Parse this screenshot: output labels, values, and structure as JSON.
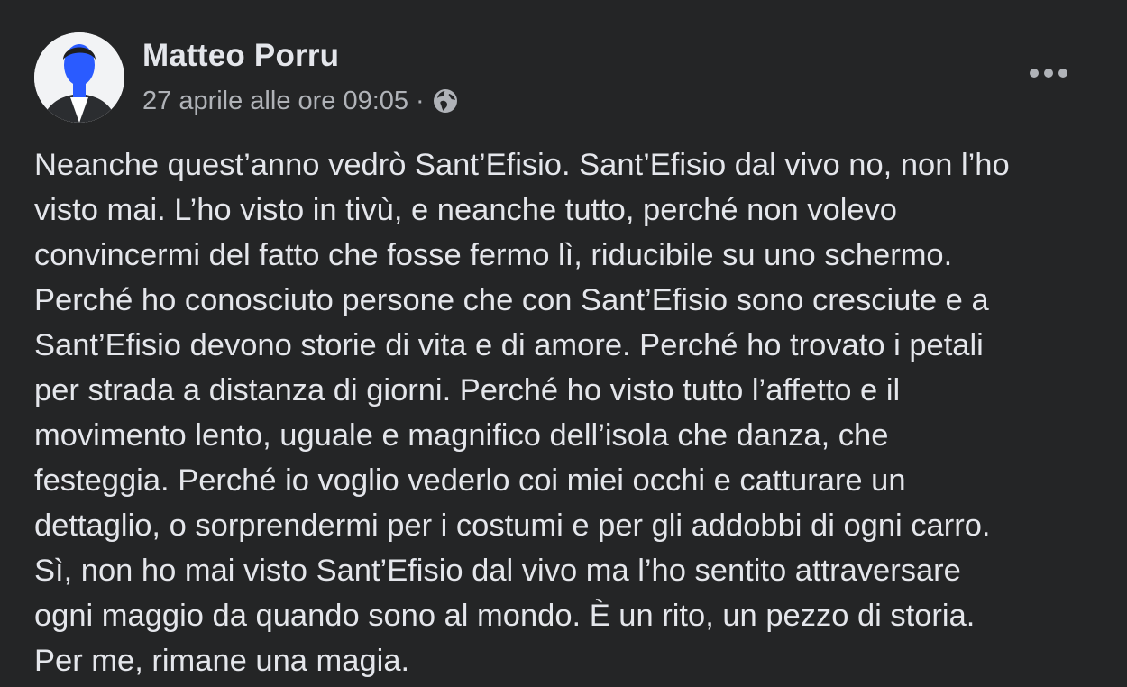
{
  "post": {
    "author": "Matteo Porru",
    "timestamp": "27 aprile alle ore 09:05",
    "separator": "·",
    "privacy_icon": "globe-icon",
    "more_icon": "more-horizontal-icon",
    "avatar_icon": "profile-avatar",
    "text": "Neanche quest’anno vedrò Sant’Efisio. Sant’Efisio dal vivo no, non l’ho\nvisto mai. L’ho visto in tivù, e neanche tutto, perché non volevo\nconvincermi del fatto che fosse fermo lì, riducibile su uno schermo.\nPerché ho conosciuto persone che con Sant’Efisio sono cresciute e a\nSant’Efisio devono storie di vita e di amore. Perché ho trovato i petali\nper strada a distanza di giorni. Perché ho visto tutto l’affetto e il\nmovimento lento, uguale e magnifico dell’isola che danza, che\nfesteggia. Perché io voglio vederlo coi miei occhi e catturare un\ndettaglio, o sorprendermi per i costumi e per gli addobbi di ogni carro.\nSì, non ho mai visto Sant’Efisio dal vivo ma l’ho sentito attraversare\nogni maggio da quando sono al mondo. È un rito, un pezzo di storia.\nPer me, rimane una magia."
  },
  "colors": {
    "background": "#242526",
    "primary_text": "#e4e6eb",
    "secondary_text": "#b0b3b8"
  }
}
